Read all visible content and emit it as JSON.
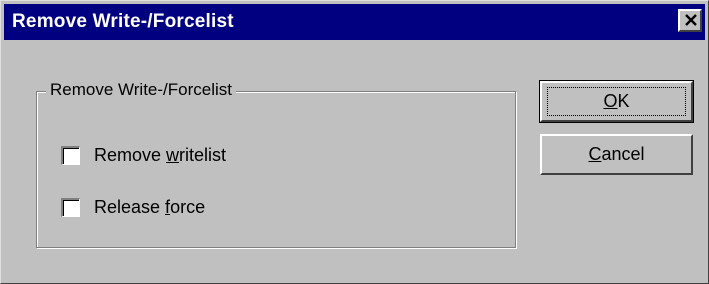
{
  "window": {
    "title": "Remove Write-/Forcelist"
  },
  "group": {
    "legend": "Remove Write-/Forcelist"
  },
  "options": [
    {
      "label_pre": "Remove ",
      "mnemonic": "w",
      "label_post": "ritelist",
      "checked": false
    },
    {
      "label_pre": "Release ",
      "mnemonic": "f",
      "label_post": "orce",
      "checked": false
    }
  ],
  "buttons": {
    "ok": {
      "mnemonic": "O",
      "rest": "K"
    },
    "cancel": {
      "mnemonic": "C",
      "rest": "ancel"
    }
  },
  "colors": {
    "titlebar": "#000080",
    "face": "#c0c0c0"
  },
  "icons": {
    "close": "close-icon"
  }
}
